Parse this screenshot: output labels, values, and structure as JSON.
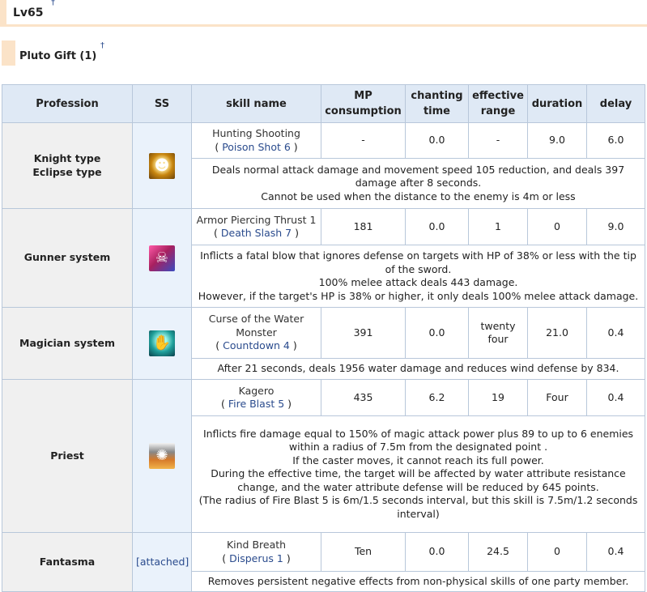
{
  "header_level": {
    "title": "Lv65",
    "mark": "†"
  },
  "header_gift": {
    "title": "Pluto Gift (1)",
    "mark": "†"
  },
  "table": {
    "columns": [
      "Profession",
      "SS",
      "skill name",
      "MP consumption",
      "chanting time",
      "effective range",
      "duration",
      "delay"
    ],
    "rows": [
      {
        "profession_line1": "Knight type",
        "profession_line2": "Eclipse type",
        "icon": "lion-icon",
        "skill": "Hunting Shooting",
        "source": "Poison Shot 6",
        "mp": "-",
        "chant": "0.0",
        "range": "-",
        "duration": "9.0",
        "delay": "6.0",
        "desc": [
          "Deals normal attack damage and movement speed 105 reduction, and deals 397 damage after 8 seconds.",
          "Cannot be used when the distance to the enemy is 4m or less"
        ]
      },
      {
        "profession": "Gunner system",
        "icon": "skull-sword-icon",
        "skill": "Armor Piercing Thrust 1",
        "source": "Death Slash 7",
        "mp": "181",
        "chant": "0.0",
        "range": "1",
        "duration": "0",
        "delay": "9.0",
        "desc": [
          "Inflicts a fatal blow that ignores defense on targets with HP of 38% or less with the tip of the sword.",
          "100% melee attack deals 443 damage.",
          "However, if the target's HP is 38% or higher, it only deals 100% melee attack damage."
        ]
      },
      {
        "profession": "Magician system",
        "icon": "water-hand-icon",
        "skill": "Curse of the Water Monster",
        "source": "Countdown 4",
        "mp": "391",
        "chant": "0.0",
        "range": "twenty four",
        "duration": "21.0",
        "delay": "0.4",
        "desc": [
          "After 21 seconds, deals 1956 water damage and reduces wind defense by 834."
        ]
      },
      {
        "profession": "Priest",
        "icon": "fire-blast-icon",
        "skill": "Kagero",
        "source": "Fire Blast 5",
        "mp": "435",
        "chant": "6.2",
        "range": "19",
        "duration": "Four",
        "delay": "0.4",
        "desc": [
          "Inflicts fire damage equal to 150% of magic attack power plus 89 to up to 6 enemies within a radius of 7.5m from the designated point .",
          "If the caster moves, it cannot reach its full power.",
          "During the effective time, the target will be affected by water attribute resistance change, and the water attribute defense will be reduced by 645 points.",
          "(The radius of Fire Blast 5 is 6m/1.5 seconds interval, but this skill is 7.5m/1.2 seconds interval)"
        ]
      },
      {
        "profession": "Fantasma",
        "ss_text": "[attached]",
        "skill": "Kind Breath",
        "source": "Disperus 1",
        "mp": "Ten",
        "chant": "0.0",
        "range": "24.5",
        "duration": "0",
        "delay": "0.4",
        "desc": [
          "Removes persistent negative effects from non-physical skills of one party member."
        ]
      }
    ]
  }
}
